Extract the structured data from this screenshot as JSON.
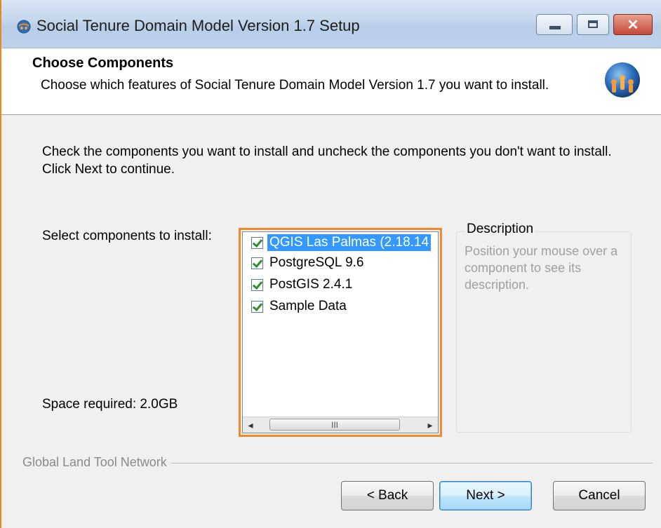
{
  "window": {
    "title": "Social Tenure Domain Model Version 1.7 Setup",
    "icon": "globe-icon",
    "controls": {
      "minimize": "minimize-icon",
      "maximize": "maximize-icon",
      "close": "✕"
    }
  },
  "header": {
    "title": "Choose Components",
    "subtitle": "Choose which features of Social Tenure Domain Model Version 1.7 you want to install.",
    "logo": "stdm-globe-logo"
  },
  "intro": "Check the components you want to install and uncheck the components you don't want to install. Click Next to continue.",
  "select_label": "Select components to install:",
  "components": [
    {
      "label": "QGIS Las Palmas (2.18.14",
      "checked": true,
      "selected": true
    },
    {
      "label": "PostgreSQL 9.6",
      "checked": true,
      "selected": false
    },
    {
      "label": "PostGIS 2.4.1",
      "checked": true,
      "selected": false
    },
    {
      "label": "Sample Data",
      "checked": true,
      "selected": false
    }
  ],
  "scrollbar": {
    "left": "◂",
    "right": "▸",
    "thumb": "III"
  },
  "description": {
    "title": "Description",
    "text": "Position your mouse over a component to see its description."
  },
  "space_required": "Space required: 2.0GB",
  "footer": {
    "brand": "Global Land Tool Network",
    "back": "< Back",
    "next": "Next >",
    "cancel": "Cancel"
  },
  "colors": {
    "highlight": "#f08a2c",
    "selection": "#3399ff",
    "check": "#2f8f2f"
  }
}
